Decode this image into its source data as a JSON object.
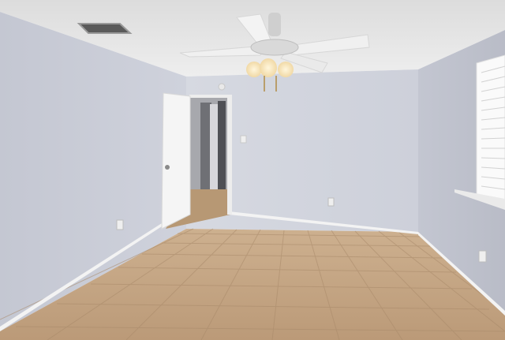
{
  "scene": {
    "type": "photo",
    "subject": "empty-room-interior",
    "elements": [
      "ceiling",
      "ceiling-fan",
      "air-vent",
      "left-wall",
      "back-wall",
      "right-wall",
      "open-door",
      "hallway",
      "window-with-blinds",
      "tile-floor",
      "baseboards",
      "outlets",
      "light-switch"
    ]
  },
  "colors": {
    "wall": "#c9ccd6",
    "wall_shadow": "#b6b9c4",
    "ceiling": "#e6e6e6",
    "floor": "#c1a17f",
    "grout": "#a98a6a",
    "baseboard": "#f2f2f2",
    "door": "#f4f4f4",
    "window_light": "#f7f7f7"
  }
}
